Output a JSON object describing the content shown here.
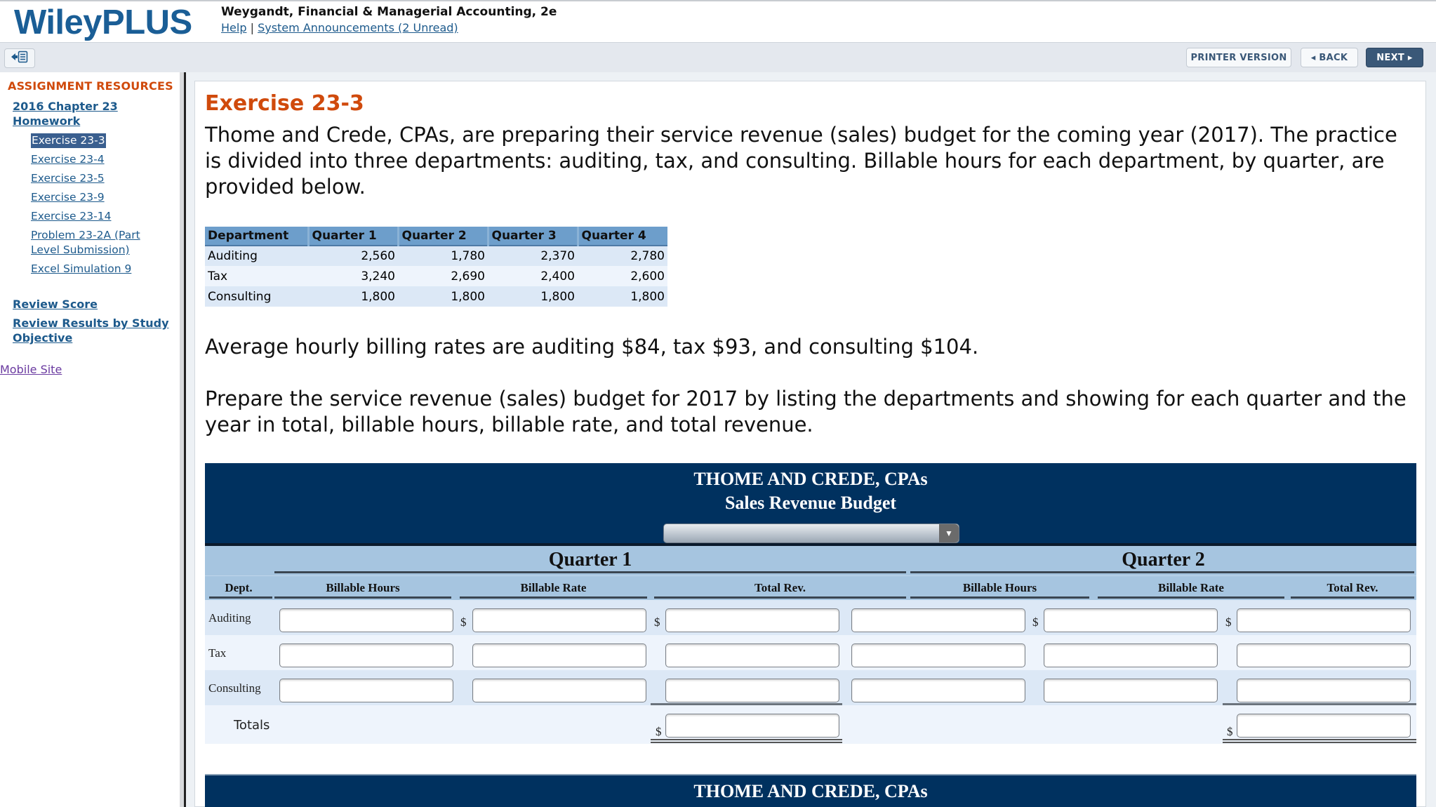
{
  "header": {
    "logo": "WileyPLUS",
    "course_title": "Weygandt, Financial & Managerial Accounting, 2e",
    "help_link": "Help",
    "separator": "|",
    "announcements_link": "System Announcements (2 Unread)"
  },
  "toolbar": {
    "collapse_icon": "collapse-sidebar-icon",
    "printer_version": "PRINTER VERSION",
    "back": "◂ BACK",
    "next": "NEXT ▸"
  },
  "sidebar": {
    "heading": "ASSIGNMENT RESOURCES",
    "assignment": "2016 Chapter 23 Homework",
    "items": [
      {
        "label": "Exercise 23-3",
        "active": true
      },
      {
        "label": "Exercise 23-4",
        "active": false
      },
      {
        "label": "Exercise 23-5",
        "active": false
      },
      {
        "label": "Exercise 23-9",
        "active": false
      },
      {
        "label": "Exercise 23-14",
        "active": false
      },
      {
        "label": "Problem 23-2A (Part Level Submission)",
        "active": false
      },
      {
        "label": "Excel Simulation 9",
        "active": false
      }
    ],
    "review_score": "Review Score",
    "review_results": "Review Results by Study Objective",
    "mobile_site": "Mobile Site"
  },
  "main": {
    "title": "Exercise 23-3",
    "intro": "Thome and Crede, CPAs, are preparing their service revenue (sales) budget for the coming year (2017). The practice is divided into three departments: auditing, tax, and consulting. Billable hours for each department, by quarter, are provided below.",
    "hours_table": {
      "headers": [
        "Department",
        "Quarter 1",
        "Quarter 2",
        "Quarter 3",
        "Quarter 4"
      ],
      "rows": [
        [
          "Auditing",
          "2,560",
          "1,780",
          "2,370",
          "2,780"
        ],
        [
          "Tax",
          "3,240",
          "2,690",
          "2,400",
          "2,600"
        ],
        [
          "Consulting",
          "1,800",
          "1,800",
          "1,800",
          "1,800"
        ]
      ]
    },
    "rates_text": "Average hourly billing rates are auditing $84, tax $93, and consulting $104.",
    "instructions": "Prepare the service revenue (sales) budget for 2017 by listing the departments and showing for each quarter and the year in total, billable hours, billable rate, and total revenue."
  },
  "budget": {
    "company": "THOME AND CREDE, CPAs",
    "title": "Sales Revenue Budget",
    "period_select_value": "",
    "quarters": [
      "Quarter 1",
      "Quarter 2"
    ],
    "dept_header": "Dept.",
    "col_headers": [
      "Billable Hours",
      "Billable Rate",
      "Total Rev."
    ],
    "rows": [
      "Auditing",
      "Tax",
      "Consulting"
    ],
    "totals_label": "Totals",
    "currency": "$",
    "inputs": {
      "q1": {
        "auditing": [
          "",
          "",
          ""
        ],
        "tax": [
          "",
          "",
          ""
        ],
        "consulting": [
          "",
          "",
          ""
        ],
        "total": ""
      },
      "q2": {
        "auditing": [
          "",
          "",
          ""
        ],
        "tax": [
          "",
          "",
          ""
        ],
        "consulting": [
          "",
          "",
          ""
        ],
        "total": ""
      }
    }
  },
  "budget2": {
    "company": "THOME AND CREDE, CPAs"
  }
}
